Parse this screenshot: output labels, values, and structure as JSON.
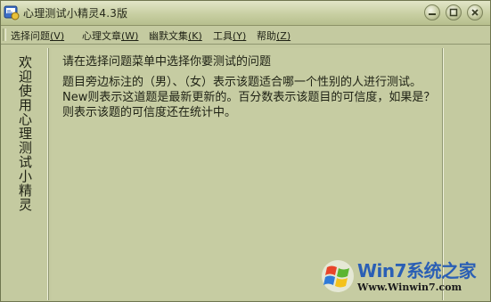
{
  "window": {
    "title": "心理测试小精灵4.3版",
    "controls": {
      "minimize": "minimize",
      "maximize": "maximize",
      "close": "close"
    }
  },
  "menu": {
    "items": [
      {
        "label": "选择问题",
        "key": "(V)"
      },
      {
        "label": "心理文章",
        "key": "(W)"
      },
      {
        "label": "幽默文集",
        "key": "(K)"
      },
      {
        "label": "工具",
        "key": "(Y)"
      },
      {
        "label": "帮助",
        "key": "(Z)"
      }
    ]
  },
  "sidebar": {
    "welcome_text": "欢迎使用心理测试小精灵"
  },
  "main": {
    "title": "请在选择问题菜单中选择你要测试的问题",
    "body": "题目旁边标注的（男）、（女）表示该题适合哪一个性别的人进行测试。New则表示这道题是最新更新的。百分数表示该题目的可信度，如果是？则表示该题的可信度还在统计中。"
  },
  "watermark": {
    "brand": "Win7系统之家",
    "url": "Www.Winwin7.com"
  },
  "colors": {
    "window_bg": "#c4caa0",
    "text": "#1e2114",
    "watermark_blue": "#2a5fb5"
  }
}
